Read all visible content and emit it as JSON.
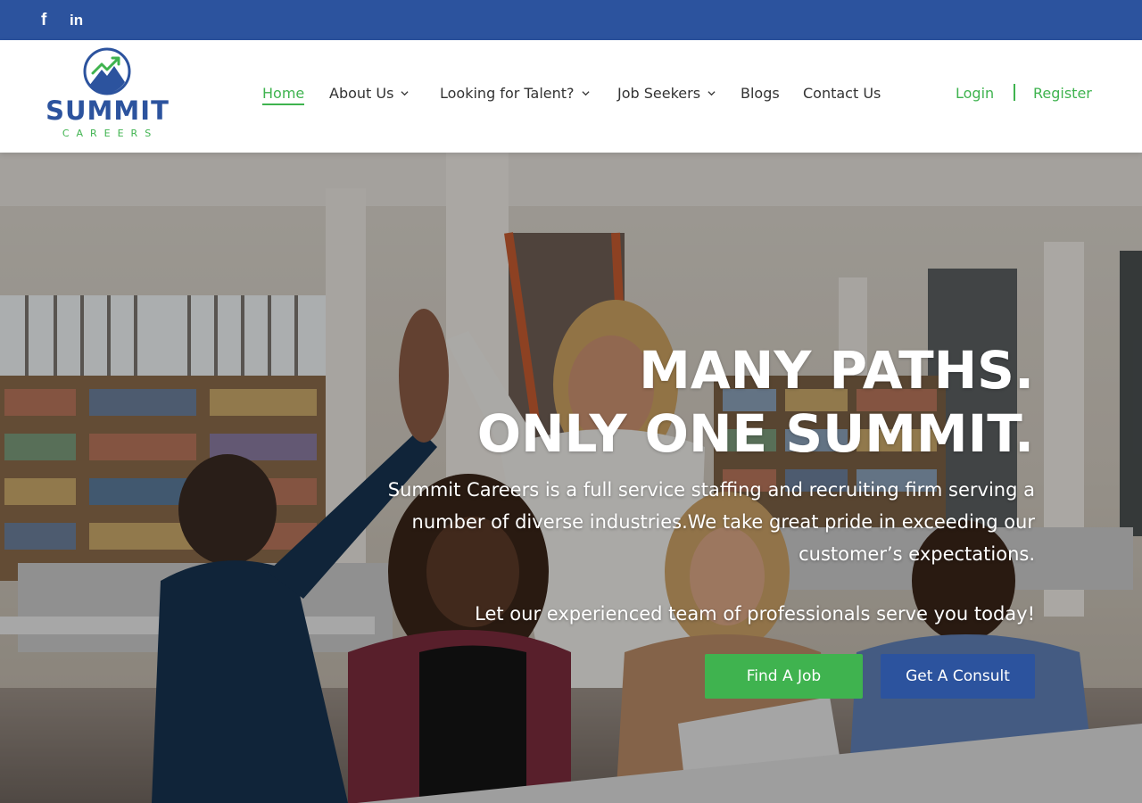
{
  "topbar": {
    "social": [
      {
        "icon": "facebook-icon",
        "glyph": "f"
      },
      {
        "icon": "linkedin-icon",
        "glyph": "in"
      }
    ]
  },
  "brand": {
    "name": "SUMMIT",
    "tagline": "CAREERS",
    "colors": {
      "primary": "#2c539e",
      "accent": "#3fb34f"
    }
  },
  "nav": {
    "items": [
      {
        "label": "Home",
        "active": true,
        "dropdown": false
      },
      {
        "label": "About Us",
        "active": false,
        "dropdown": true
      },
      {
        "label": "Looking for Talent?",
        "active": false,
        "dropdown": true
      },
      {
        "label": "Job Seekers",
        "active": false,
        "dropdown": true
      },
      {
        "label": "Blogs",
        "active": false,
        "dropdown": false
      },
      {
        "label": "Contact Us",
        "active": false,
        "dropdown": false
      }
    ],
    "login": "Login",
    "register": "Register"
  },
  "hero": {
    "headline_line1": "MANY PATHS.",
    "headline_line2": "ONLY ONE SUMMIT.",
    "description": "Summit Careers is a full service staffing and recruiting firm serving a number of diverse industries.We take great pride in exceeding our customer’s expectations.",
    "cta_text": "Let our experienced team of professionals serve you today!",
    "buttons": {
      "find_job": "Find A Job",
      "get_consult": "Get A Consult"
    }
  }
}
